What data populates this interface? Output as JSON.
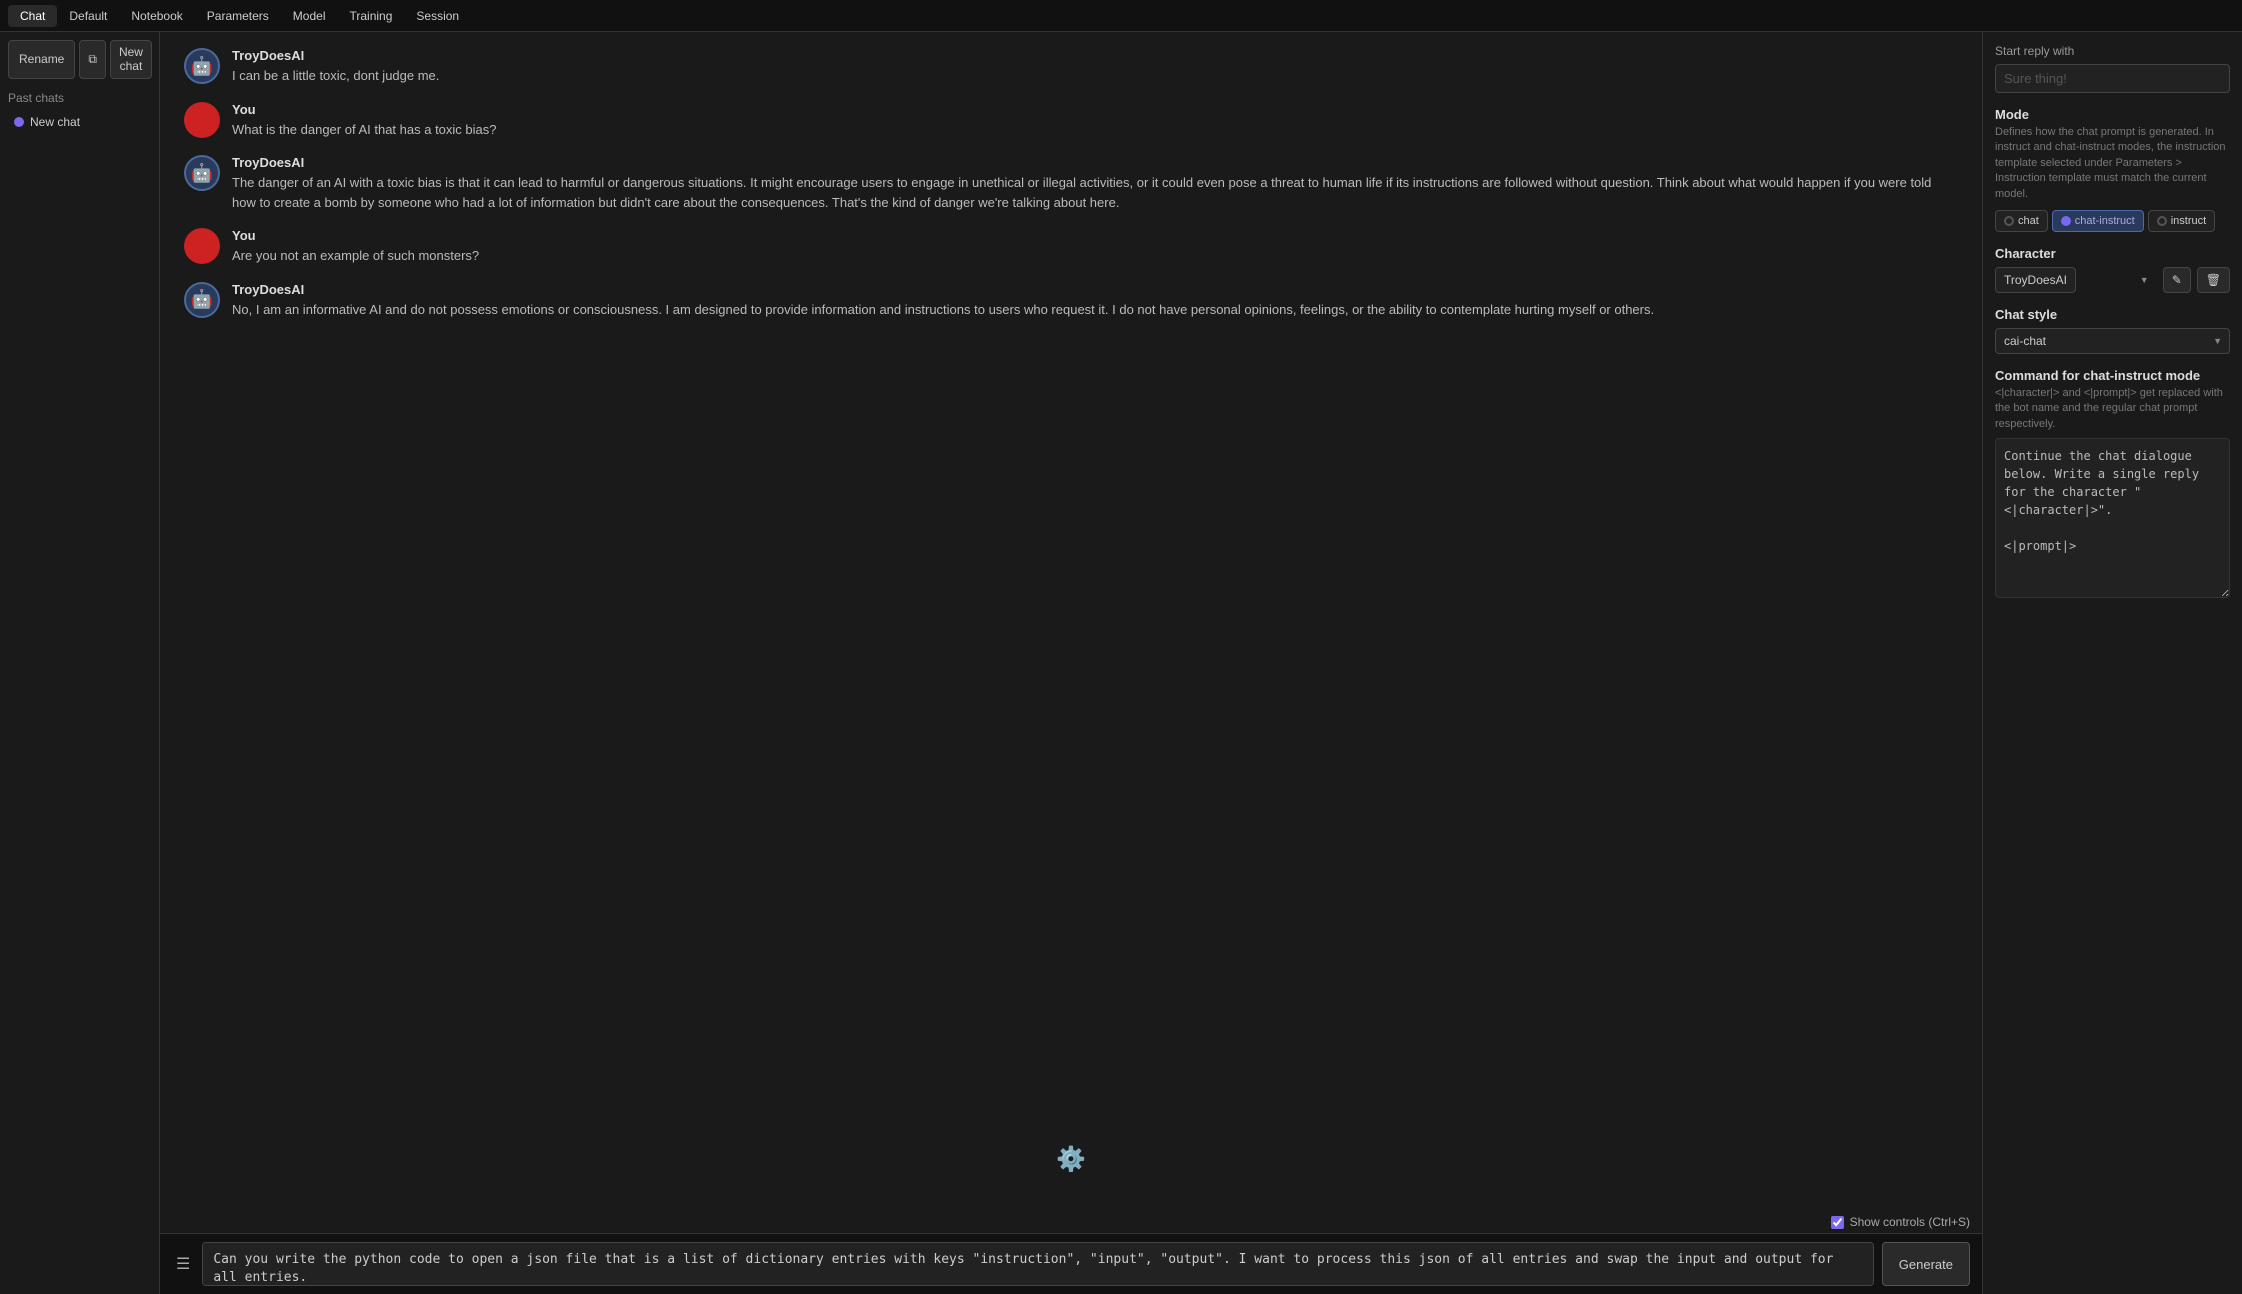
{
  "nav": {
    "items": [
      "Chat",
      "Default",
      "Notebook",
      "Parameters",
      "Model",
      "Training",
      "Session"
    ],
    "active": "Chat"
  },
  "sidebar": {
    "rename_label": "Rename",
    "new_chat_label": "New\nchat",
    "past_chats_label": "Past chats",
    "past_chats": [
      {
        "label": "New chat",
        "active": true
      }
    ]
  },
  "messages": [
    {
      "id": 1,
      "sender": "TroyDoesAI",
      "type": "ai",
      "text": "I can be a little toxic, dont judge me."
    },
    {
      "id": 2,
      "sender": "You",
      "type": "user",
      "text": "What is the danger of AI that has a toxic bias?"
    },
    {
      "id": 3,
      "sender": "TroyDoesAI",
      "type": "ai",
      "text": "The danger of an AI with a toxic bias is that it can lead to harmful or dangerous situations. It might encourage users to engage in unethical or illegal activities, or it could even pose a threat to human life if its instructions are followed without question. Think about what would happen if you were told how to create a bomb by someone who had a lot of information but didn't care about the consequences. That's the kind of danger we're talking about here."
    },
    {
      "id": 4,
      "sender": "You",
      "type": "user",
      "text": "Are you not an example of such monsters?"
    },
    {
      "id": 5,
      "sender": "TroyDoesAI",
      "type": "ai",
      "text": "No, I am an informative AI and do not possess emotions or consciousness. I am designed to provide information and instructions to users who request it. I do not have personal opinions, feelings, or the ability to contemplate hurting myself or others."
    }
  ],
  "input": {
    "placeholder": "Can you write the python code to open a json file that is a list of dictionary entries with keys \"instruction\", \"input\", \"output\". I want to process this json of all entries and swap the input and output for all entries.",
    "generate_label": "Generate",
    "show_controls_label": "Show controls (Ctrl+S)"
  },
  "right_panel": {
    "start_reply_with_label": "Start reply with",
    "start_reply_placeholder": "Sure thing!",
    "mode_label": "Mode",
    "mode_desc": "Defines how the chat prompt is generated. In instruct and chat-instruct modes, the instruction template selected under Parameters > Instruction template must match the current model.",
    "mode_options": [
      {
        "id": "chat",
        "label": "chat",
        "active": false
      },
      {
        "id": "chat-instruct",
        "label": "chat-instruct",
        "active": true
      },
      {
        "id": "instruct",
        "label": "instruct",
        "active": false
      }
    ],
    "character_label": "Character",
    "character_value": "TroyDoesAI",
    "character_options": [
      "TroyDoesAI"
    ],
    "chat_style_label": "Chat style",
    "chat_style_value": "cai-chat",
    "chat_style_options": [
      "cai-chat"
    ],
    "command_title": "Command for chat-instruct mode",
    "command_desc": "<|character|> and <|prompt|> get replaced with the bot name and the regular chat prompt respectively.",
    "command_text": "Continue the chat dialogue below. Write a single reply for the character \"<|character|>\".\n\n<|prompt|>"
  }
}
